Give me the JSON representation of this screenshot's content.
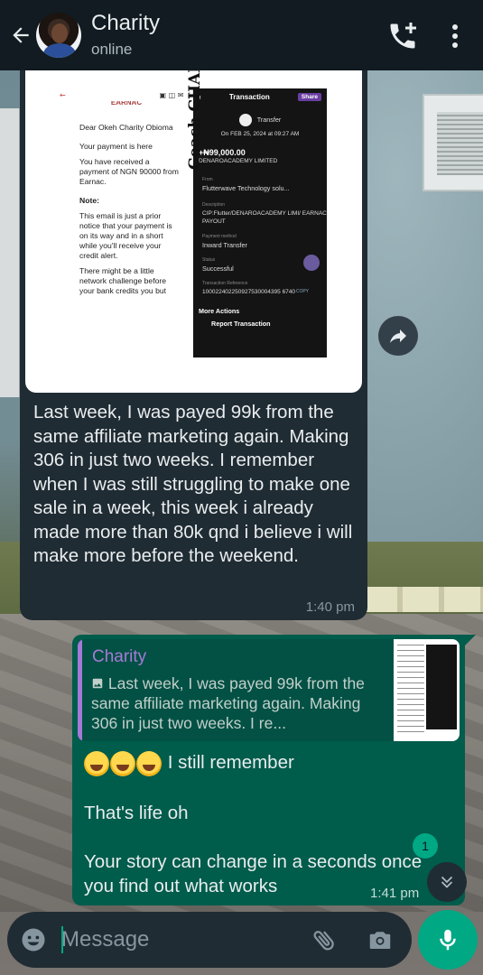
{
  "header": {
    "contact_name": "Charity",
    "status": "online"
  },
  "incoming_message": {
    "image": {
      "email": {
        "brand": "EARNAC",
        "greeting": "Dear Okeh Charity Obioma",
        "line1": "Your payment is here",
        "line2": "You have received a payment of NGN 90000 from Earnac.",
        "note_label": "Note:",
        "note1": "This email is just a prior notice that your payment is on its way and in a short while you'll receive your credit alert.",
        "note2": "There might be a little network challenge before your bank credits you but"
      },
      "watermark": "Coach CHARITY",
      "transaction": {
        "title": "Transaction",
        "share": "Share",
        "type": "Transfer",
        "date": "On FEB 25, 2024 at 09:27 AM",
        "amount": "+₦99,000.00",
        "sender": "DENAROACADEMY LIMITED",
        "from_label": "From",
        "from": "Flutterwave Technology solu...",
        "desc_label": "Description",
        "desc": "CIP:Flutter/DENAROACADEMY LIMI/ EARNAC PAYOUT",
        "method_label": "Payment method",
        "method": "Inward Transfer",
        "status_label": "Status",
        "status": "Successful",
        "ref_label": "Transaction Reference",
        "ref": "100022402250927530004395 6740",
        "copy": "COPY",
        "more": "More Actions",
        "report": "Report Transaction"
      }
    },
    "text": "Last week, I was payed 99k from the same affiliate marketing again. Making 306 in just two weeks.  I remember when I was still struggling to make one sale in a week, this week i already made more than 80k qnd i believe  i will make more before the weekend.",
    "time": "1:40 pm"
  },
  "outgoing_message": {
    "quote": {
      "author": "Charity",
      "text": "Last week, I was payed 99k from the same affiliate marketing again. Making 306 in just two weeks.  I re..."
    },
    "line1": "I still remember",
    "line2": "That's life oh",
    "line3": "Your story can change in a seconds once you find out what works",
    "time": "1:41 pm"
  },
  "unread_count": "1",
  "composer": {
    "placeholder": "Message"
  },
  "colors": {
    "header_bg": "#111b21",
    "incoming_bubble": "#202c33",
    "outgoing_bubble": "#005c4b",
    "accent": "#00a884",
    "quote_name": "#a57ad6"
  },
  "icons": [
    "back-arrow-icon",
    "add-call-icon",
    "more-vert-icon",
    "forward-icon",
    "chevron-double-down-icon",
    "emoji-icon",
    "attach-icon",
    "camera-icon",
    "mic-icon"
  ]
}
